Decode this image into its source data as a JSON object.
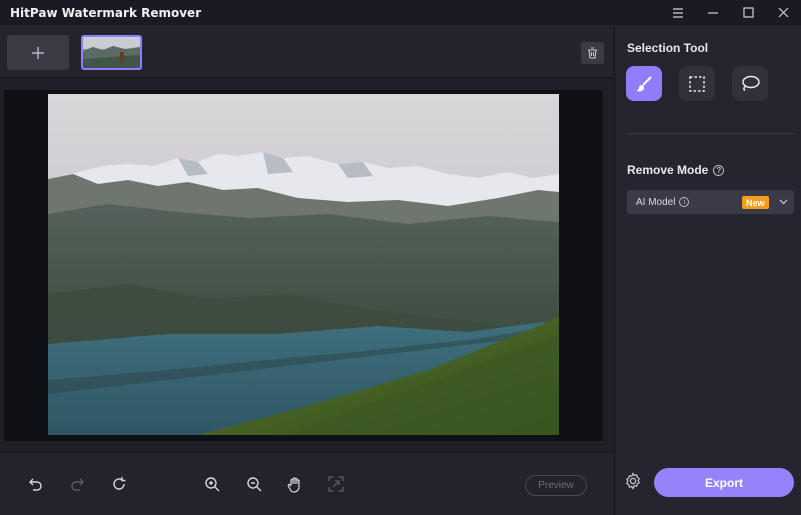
{
  "window": {
    "title": "HitPaw Watermark Remover",
    "controls": [
      "menu-icon",
      "minimize-icon",
      "maximize-icon",
      "close-icon"
    ]
  },
  "thumbnails": {
    "add_icon": "plus-icon",
    "items": [
      {
        "selected": true
      }
    ],
    "delete_icon": "trash-icon"
  },
  "right_panel": {
    "selection_tool_title": "Selection Tool",
    "tools": [
      {
        "name": "brush",
        "icon": "brush-icon",
        "active": true
      },
      {
        "name": "rectangle",
        "icon": "rectangle-select-icon",
        "active": false
      },
      {
        "name": "lasso",
        "icon": "lasso-icon",
        "active": false
      }
    ],
    "remove_mode_title": "Remove Mode",
    "remove_mode": {
      "selected": "AI Model",
      "badge": "New"
    },
    "export_label": "Export"
  },
  "bottom_toolbar": {
    "icons": [
      "undo-icon",
      "redo-icon",
      "reset-icon",
      "zoom-in-icon",
      "zoom-out-icon",
      "hand-icon",
      "fit-screen-icon"
    ],
    "preview_label": "Preview"
  },
  "colors": {
    "accent": "#8f7dfc",
    "badge": "#f59d1e",
    "background": "#1e1f27",
    "panel": "#24252e"
  }
}
